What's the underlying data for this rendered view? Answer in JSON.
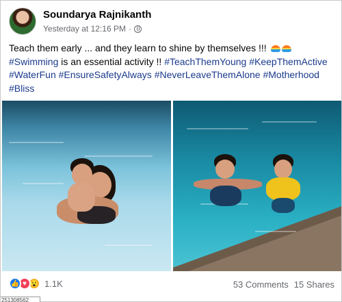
{
  "post": {
    "author": "Soundarya Rajnikanth",
    "timestamp": "Yesterday at 12:16 PM",
    "separator": "·",
    "privacy_icon": "globe-icon",
    "menu_icon": "more-options-icon",
    "menu_glyph": "···"
  },
  "caption": {
    "line1_text": "Teach them early ... and they learn to shine by themselves !!! ",
    "line2_text": "#Swimming is an essential activity !! ",
    "line2_tags": [
      "#TeachThemYoung",
      "#KeepThemActive"
    ],
    "line3_tags": [
      "#WaterFun",
      "#EnsureSafetyAlways",
      "#NeverLeaveThemAlone",
      "#Motherhood"
    ],
    "line4_tags": [
      "#Bliss"
    ]
  },
  "photos": [
    {
      "name": "photo-mother-child-pool"
    },
    {
      "name": "photo-children-swimming"
    }
  ],
  "engagement": {
    "reaction_icons": [
      "like-icon",
      "love-icon",
      "wow-icon"
    ],
    "reaction_glyphs": {
      "like": "👍",
      "love": "♥",
      "wow": "😮"
    },
    "reactions_count": "1.1K",
    "comments": "53 Comments",
    "shares": "15 Shares"
  },
  "bottom_fragment": "251308562",
  "colors": {
    "hashtag": "#1a3a8c",
    "meta": "#65676b",
    "like": "#1877f2",
    "love": "#f33e58",
    "wow": "#f7b125"
  }
}
